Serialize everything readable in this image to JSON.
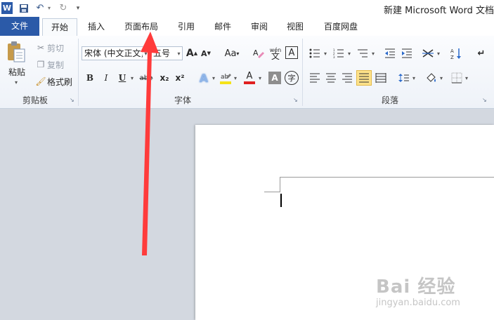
{
  "window": {
    "title": "新建 Microsoft Word 文档"
  },
  "tabs": [
    {
      "label": "文件"
    },
    {
      "label": "开始"
    },
    {
      "label": "插入"
    },
    {
      "label": "页面布局"
    },
    {
      "label": "引用"
    },
    {
      "label": "邮件"
    },
    {
      "label": "审阅"
    },
    {
      "label": "视图"
    },
    {
      "label": "百度网盘"
    }
  ],
  "clipboard": {
    "group_label": "剪贴板",
    "paste": "粘贴",
    "cut": "剪切",
    "copy": "复制",
    "format_painter": "格式刷"
  },
  "font": {
    "group_label": "字体",
    "font_name": "宋体 (中文正文)",
    "font_size": "五号",
    "bold": "B",
    "italic": "I",
    "underline": "U",
    "strike": "abe",
    "subscript": "x₂",
    "superscript": "x²",
    "grow": "A",
    "shrink": "A",
    "change_case": "Aa",
    "clear_format": "A",
    "phonetic": "wén",
    "char_border": "A",
    "text_effect": "A",
    "font_color": "A",
    "char_shading": "A",
    "enclose": "字"
  },
  "paragraph": {
    "group_label": "段落"
  },
  "watermark": {
    "brand": "Bai 经验",
    "url": "jingyan.baidu.com"
  },
  "colors": {
    "accent_red": "#ff3b3b",
    "file_tab": "#2b5aa8",
    "highlight_yellow": "#f5e31a",
    "font_red": "#e02020"
  }
}
